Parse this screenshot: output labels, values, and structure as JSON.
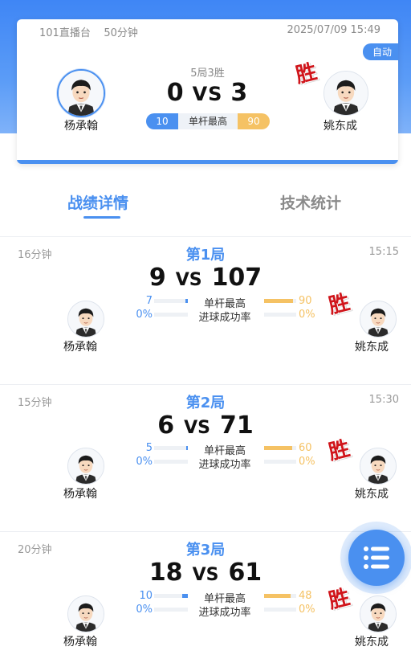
{
  "header": {
    "platform": "101直播台",
    "duration": "50分钟",
    "datetime": "2025/07/09 15:49",
    "auto_label": "自动",
    "format": "5局3胜",
    "score_left": "0",
    "vs": "VS",
    "score_right": "3",
    "highest_break_label": "单杆最高",
    "highest_break_left": "10",
    "highest_break_right": "90",
    "win_mark": "胜"
  },
  "players": {
    "left": {
      "name": "杨承翰",
      "avatar": "player-avatar"
    },
    "right": {
      "name": "姚东成",
      "avatar": "player-avatar"
    }
  },
  "tabs": [
    {
      "label": "战绩详情",
      "active": true
    },
    {
      "label": "技术统计",
      "active": false
    }
  ],
  "games": [
    {
      "duration": "16分钟",
      "title": "第1局",
      "time": "15:15",
      "score_left": "9",
      "vs": "VS",
      "score_right": "107",
      "break_label": "单杆最高",
      "break_left": "7",
      "break_right": "90",
      "break_left_fraction": 0.07,
      "break_right_fraction": 0.9,
      "pot_label": "进球成功率",
      "pot_left": "0%",
      "pot_right": "0%",
      "pot_left_fraction": 0,
      "pot_right_fraction": 0,
      "left_name": "杨承翰",
      "right_name": "姚东成",
      "win_mark": "胜"
    },
    {
      "duration": "15分钟",
      "title": "第2局",
      "time": "15:30",
      "score_left": "6",
      "vs": "VS",
      "score_right": "71",
      "break_label": "单杆最高",
      "break_left": "5",
      "break_right": "60",
      "break_left_fraction": 0.05,
      "break_right_fraction": 0.88,
      "pot_label": "进球成功率",
      "pot_left": "0%",
      "pot_right": "0%",
      "pot_left_fraction": 0,
      "pot_right_fraction": 0,
      "left_name": "杨承翰",
      "right_name": "姚东成",
      "win_mark": "胜"
    },
    {
      "duration": "20分钟",
      "title": "第3局",
      "time": "",
      "score_left": "18",
      "vs": "VS",
      "score_right": "61",
      "break_label": "单杆最高",
      "break_left": "10",
      "break_right": "48",
      "break_left_fraction": 0.17,
      "break_right_fraction": 0.83,
      "pot_label": "进球成功率",
      "pot_left": "0%",
      "pot_right": "0%",
      "pot_left_fraction": 0,
      "pot_right_fraction": 0,
      "left_name": "杨承翰",
      "right_name": "姚东成",
      "win_mark": "胜"
    }
  ],
  "fab": {
    "icon": "list-menu-icon"
  },
  "colors": {
    "primary": "#4a90f0",
    "accent": "#f5c264",
    "win": "#d0151b"
  }
}
